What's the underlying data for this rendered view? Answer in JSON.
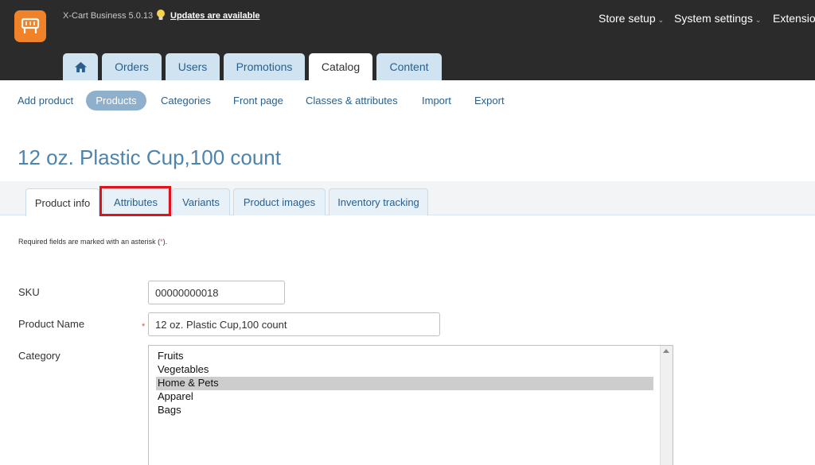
{
  "header": {
    "version": "X-Cart Business 5.0.13",
    "updates_link": "Updates are available",
    "nav": [
      {
        "label": "Store setup"
      },
      {
        "label": "System settings"
      },
      {
        "label": "Extensions"
      }
    ]
  },
  "main_tabs": [
    {
      "label": "Orders"
    },
    {
      "label": "Users"
    },
    {
      "label": "Promotions"
    },
    {
      "label": "Catalog",
      "active": true
    },
    {
      "label": "Content"
    }
  ],
  "subnav": [
    {
      "label": "Add product"
    },
    {
      "label": "Products",
      "active": true
    },
    {
      "label": "Categories"
    },
    {
      "label": "Front page"
    },
    {
      "label": "Classes & attributes"
    },
    {
      "label": "Import"
    },
    {
      "label": "Export"
    }
  ],
  "page_title": "12 oz. Plastic Cup,100 count",
  "product_tabs": [
    {
      "label": "Product info",
      "active": true
    },
    {
      "label": "Attributes",
      "highlighted": true
    },
    {
      "label": "Variants"
    },
    {
      "label": "Product images"
    },
    {
      "label": "Inventory tracking"
    }
  ],
  "required_note": {
    "before": "Required fields are marked with an asterisk (",
    "asterisk": "*",
    "after": ")."
  },
  "form": {
    "sku": {
      "label": "SKU",
      "value": "00000000018"
    },
    "product_name": {
      "label": "Product Name",
      "value": "12 oz. Plastic Cup,100 count",
      "required_marker": "*"
    },
    "category": {
      "label": "Category",
      "options": [
        "Fruits",
        "Vegetables",
        "Home & Pets",
        "Apparel",
        "Bags"
      ],
      "selected": "Home & Pets"
    }
  },
  "colors": {
    "header_bg": "#2b2b2b",
    "logo": "#f0832a",
    "accent": "#4d84ad",
    "highlight_box": "#e0121b"
  },
  "icons": {
    "logo": "cart-logo-icon",
    "bulb": "lightbulb-icon",
    "home": "home-icon"
  }
}
